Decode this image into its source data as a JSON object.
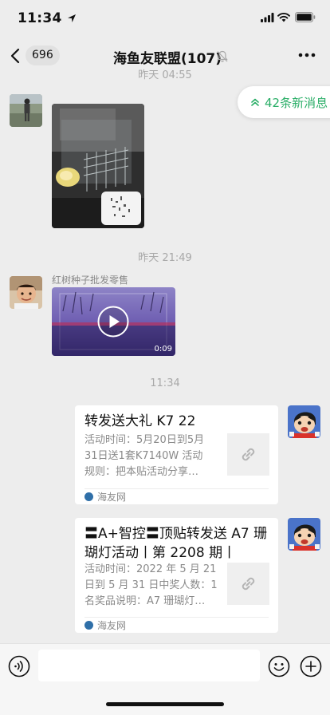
{
  "status_bar": {
    "time": "11:34"
  },
  "nav": {
    "unread_count": "696",
    "title": "海鱼友联盟(107)"
  },
  "banner": {
    "new_messages": "42条新消息"
  },
  "timestamps": [
    "昨天 04:55",
    "昨天 21:49",
    "11:34"
  ],
  "messages": [
    {
      "type": "image"
    },
    {
      "type": "video",
      "sender_name": "红树种子批发零售",
      "duration": "0:09"
    },
    {
      "type": "link",
      "title": "转发送大礼 K7 22",
      "desc_lines": [
        "活动时间：5月20日到5月",
        "31日送1套K7140W 活动",
        "规则：把本贴活动分享…"
      ],
      "source": "海友网"
    },
    {
      "type": "link",
      "title_lines": [
        "〓A+智控〓顶贴转发送 A7 珊",
        "瑚灯活动丨第 2208 期丨"
      ],
      "desc_lines": [
        "活动时间：2022 年 5 月 21",
        "日到 5 月 31 日中奖人数：1",
        "名奖品说明：A7 珊瑚灯…"
      ],
      "source": "海友网"
    }
  ],
  "icons": [
    "back-chevron-icon",
    "mute-icon",
    "more-icon",
    "double-chevron-up-icon",
    "play-icon",
    "link-icon",
    "voice-icon",
    "emoji-icon",
    "plus-icon"
  ],
  "colors": {
    "accent_green": "#2aae67",
    "background": "#ededed",
    "source_icon": "#2f6fa8"
  }
}
